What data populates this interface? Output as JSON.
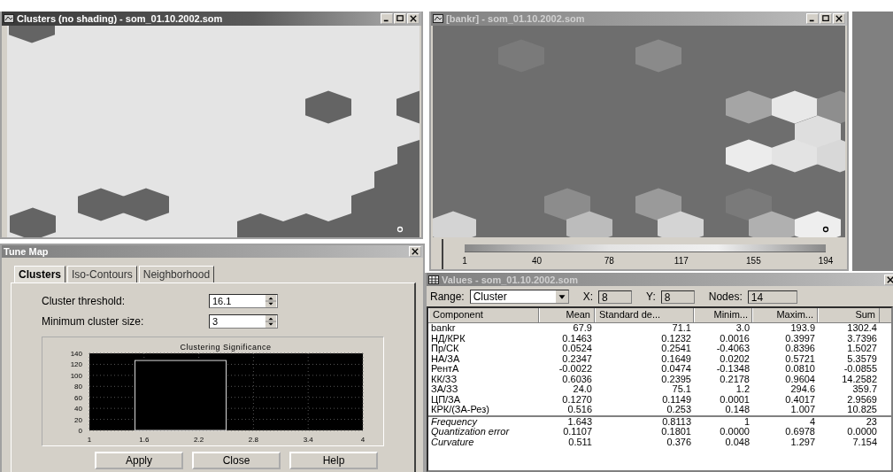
{
  "cluster_window": {
    "title": "Clusters (no shading) - som_01.10.2002.som"
  },
  "component_window": {
    "title": "[bankr] - som_01.10.2002.som"
  },
  "color_scale": {
    "ticks": [
      "1",
      "40",
      "78",
      "117",
      "155",
      "194"
    ]
  },
  "tune_map": {
    "title": "Tune Map",
    "tabs": [
      {
        "label": "Clusters",
        "selected": true
      },
      {
        "label": "Iso-Contours",
        "selected": false
      },
      {
        "label": "Neighborhood",
        "selected": false
      }
    ],
    "fields": [
      {
        "label": "Cluster threshold:",
        "value": "16.1"
      },
      {
        "label": "Minimum cluster size:",
        "value": "3"
      }
    ],
    "chart_data": {
      "type": "bar",
      "grid": true,
      "title": "Clustering Significance",
      "x": [
        2
      ],
      "values": [
        127
      ],
      "xlim": [
        1,
        4
      ],
      "ylim": [
        0,
        140
      ],
      "xticks": [
        1,
        1.6,
        2.2,
        2.8,
        3.4,
        4
      ],
      "yticks": [
        0,
        20,
        40,
        60,
        80,
        100,
        120,
        140
      ]
    },
    "buttons": [
      "Apply",
      "Close",
      "Help"
    ]
  },
  "values_window": {
    "title": "Values - som_01.10.2002.som",
    "range": {
      "label": "Range:",
      "value": "Cluster"
    },
    "x": {
      "label": "X:",
      "value": "8"
    },
    "y": {
      "label": "Y:",
      "value": "8"
    },
    "nodes": {
      "label": "Nodes:",
      "value": "14"
    },
    "table": {
      "columns": [
        "Component",
        "Mean",
        "Standard de...",
        "Minim...",
        "Maxim...",
        "Sum"
      ],
      "rows": [
        {
          "kind": "component",
          "cells": [
            "bankr",
            "67.9",
            "71.1",
            "3.0",
            "193.9",
            "1302.4"
          ]
        },
        {
          "kind": "component",
          "cells": [
            "НД/КРК",
            "0.1463",
            "0.1232",
            "0.0016",
            "0.3997",
            "3.7396"
          ]
        },
        {
          "kind": "component",
          "cells": [
            "Пр/СК",
            "0.0524",
            "0.2541",
            "-0.4063",
            "0.8396",
            "1.5027"
          ]
        },
        {
          "kind": "component",
          "cells": [
            "НА/ЗА",
            "0.2347",
            "0.1649",
            "0.0202",
            "0.5721",
            "5.3579"
          ]
        },
        {
          "kind": "component",
          "cells": [
            "РентА",
            "-0.0022",
            "0.0474",
            "-0.1348",
            "0.0810",
            "-0.0855"
          ]
        },
        {
          "kind": "component",
          "cells": [
            "КК/ЗЗ",
            "0.6036",
            "0.2395",
            "0.2178",
            "0.9604",
            "14.2582"
          ]
        },
        {
          "kind": "component",
          "cells": [
            "ЗА/ЗЗ",
            "24.0",
            "75.1",
            "1.2",
            "294.6",
            "359.7"
          ]
        },
        {
          "kind": "component",
          "cells": [
            "ЦП/ЗА",
            "0.1270",
            "0.1149",
            "0.0001",
            "0.4017",
            "2.9569"
          ]
        },
        {
          "kind": "component",
          "cells": [
            "КРК/(ЗА-Рез)",
            "0.516",
            "0.253",
            "0.148",
            "1.007",
            "10.825"
          ]
        },
        {
          "kind": "statistic",
          "cells": [
            "Frequency",
            "1.643",
            "0.8113",
            "1",
            "4",
            "23"
          ]
        },
        {
          "kind": "statistic",
          "cells": [
            "Quantization error",
            "0.1107",
            "0.1801",
            "0.0000",
            "0.6978",
            "0.0000"
          ]
        },
        {
          "kind": "statistic",
          "cells": [
            "Curvature",
            "0.511",
            "0.376",
            "0.048",
            "1.297",
            "7.154"
          ]
        }
      ]
    }
  }
}
